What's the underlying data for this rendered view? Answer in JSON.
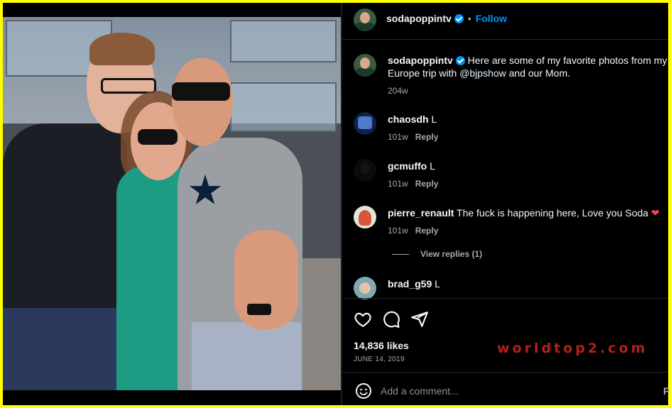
{
  "post": {
    "username": "sodapoppintv",
    "follow_label": "Follow",
    "separator": "•"
  },
  "caption": {
    "username": "sodapoppintv",
    "text_before": " Here are some of my favorite photos from my Europe trip with ",
    "mention": "@bjpshow",
    "text_after": " and our Mom.",
    "time": "204w"
  },
  "comments": [
    {
      "username": "chaosdh",
      "text": "L",
      "time": "101w",
      "reply_label": "Reply"
    },
    {
      "username": "gcmuffo",
      "text": "L",
      "time": "101w",
      "reply_label": "Reply"
    },
    {
      "username": "pierre_renault",
      "text": "The fuck is happening here, Love you Soda",
      "emoji": "❤",
      "time": "101w",
      "reply_label": "Reply"
    },
    {
      "username": "brad_g59",
      "text": "L"
    }
  ],
  "view_replies_label": "View replies (1)",
  "likes_label": "14,836 likes",
  "date_label": "JUNE 14, 2019",
  "watermark": "worldtop2.com",
  "add_comment": {
    "placeholder": "Add a comment...",
    "post_label": "P"
  },
  "colors": {
    "frame": "#ffff00",
    "accent": "#0095f6",
    "heart": "#ed4956",
    "watermark": "#b5201c"
  },
  "icons": [
    "like-icon",
    "comment-icon",
    "share-icon",
    "emoji-icon",
    "verified-icon"
  ]
}
